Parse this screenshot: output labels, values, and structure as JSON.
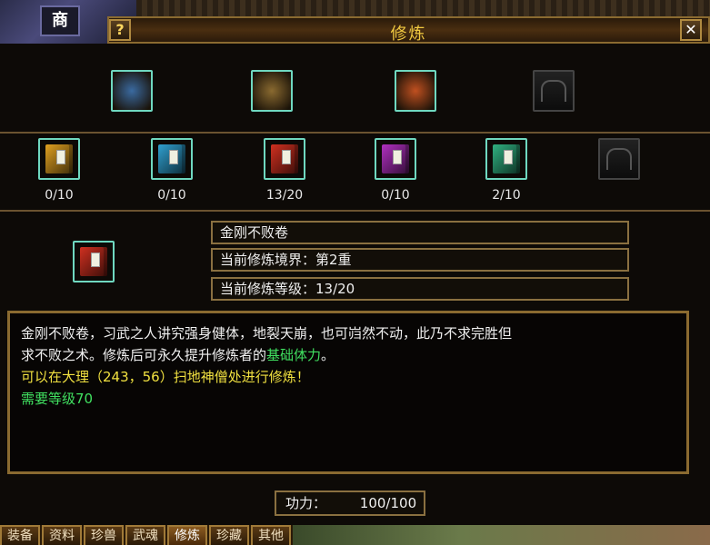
{
  "scene": {
    "shop_sign": "商"
  },
  "window": {
    "title": "修炼",
    "help_label": "?",
    "close_label": "✕"
  },
  "top_row": [
    {
      "icon": "scroll-bundle-icon",
      "color": "#3a6aa0"
    },
    {
      "icon": "dynamite-bundle-icon",
      "color": "#8a6a30"
    },
    {
      "icon": "firecracker-bundle-icon",
      "color": "#c05020"
    },
    {
      "icon": "empty-slot-icon",
      "color": "#222222"
    }
  ],
  "books": [
    {
      "icon": "yellow-book-icon",
      "color": "#e0a020",
      "count": "0/10"
    },
    {
      "icon": "blue-book-icon",
      "color": "#30a0d0",
      "count": "0/10"
    },
    {
      "icon": "red-book-icon",
      "color": "#d03020",
      "count": "13/20"
    },
    {
      "icon": "purple-book-icon",
      "color": "#b030c0",
      "count": "0/10"
    },
    {
      "icon": "green-book-icon",
      "color": "#30b080",
      "count": "2/10"
    },
    {
      "icon": "empty-slot-icon",
      "color": "#222222",
      "count": ""
    }
  ],
  "selected": {
    "icon": "red-book-icon",
    "color": "#d03020",
    "name": "金刚不败卷",
    "realm": "当前修炼境界：第2重",
    "level": "当前修炼等级：13/20"
  },
  "description": {
    "line1": "金刚不败卷，习武之人讲究强身健体，地裂天崩，也可岿然不动，此乃不求完胜但",
    "line2_prefix": "求不败之术。修炼后可永久提升修炼者的",
    "line2_highlight": "基础体力",
    "line2_suffix": "。",
    "location": "可以在大理（243，56）扫地神僧处进行修炼！",
    "requirement": "需要等级70"
  },
  "power": {
    "label": "功力：",
    "value": "100/100"
  },
  "tabs": [
    {
      "label": "装备",
      "active": false
    },
    {
      "label": "资料",
      "active": false
    },
    {
      "label": "珍兽",
      "active": false
    },
    {
      "label": "武魂",
      "active": false
    },
    {
      "label": "修炼",
      "active": true
    },
    {
      "label": "珍藏",
      "active": false
    },
    {
      "label": "其他",
      "active": false
    }
  ]
}
